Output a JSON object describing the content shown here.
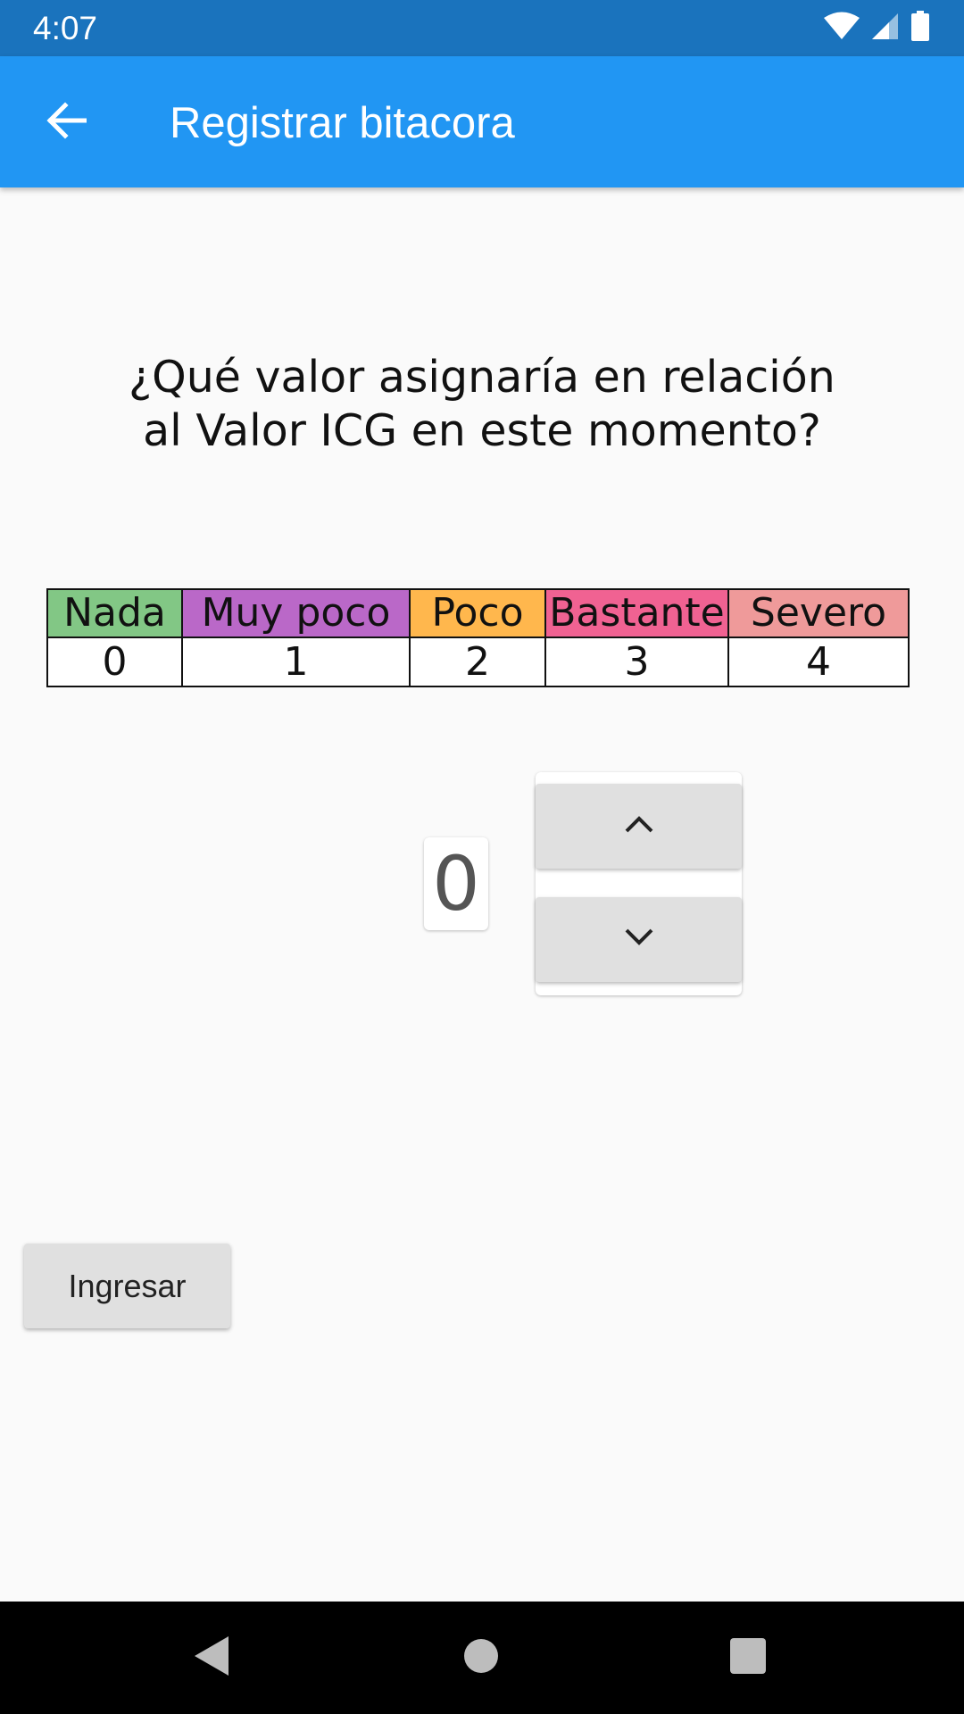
{
  "status_bar": {
    "time": "4:07",
    "icons": [
      "wifi-icon",
      "cellular-signal-icon",
      "battery-icon"
    ]
  },
  "app_bar": {
    "title": "Registrar bitacora",
    "back_icon": "arrow-back-icon",
    "background": "#2196f3"
  },
  "question": {
    "text": "¿Qué valor asignaría en relación\nal Valor ICG en este momento?"
  },
  "scale": {
    "levels": [
      {
        "label": "Nada",
        "value": "0",
        "color": "#82c785"
      },
      {
        "label": "Muy poco",
        "value": "1",
        "color": "#ba68c8"
      },
      {
        "label": "Poco",
        "value": "2",
        "color": "#ffb74d"
      },
      {
        "label": "Bastante",
        "value": "3",
        "color": "#f06292"
      },
      {
        "label": "Severo",
        "value": "4",
        "color": "#ef9a9a"
      }
    ]
  },
  "stepper": {
    "current_value": "0",
    "increment_icon": "chevron-up-icon",
    "decrement_icon": "chevron-down-icon"
  },
  "submit": {
    "label": "Ingresar"
  },
  "nav_bar": {
    "icons": [
      "nav-back-icon",
      "nav-home-icon",
      "nav-recents-icon"
    ]
  }
}
